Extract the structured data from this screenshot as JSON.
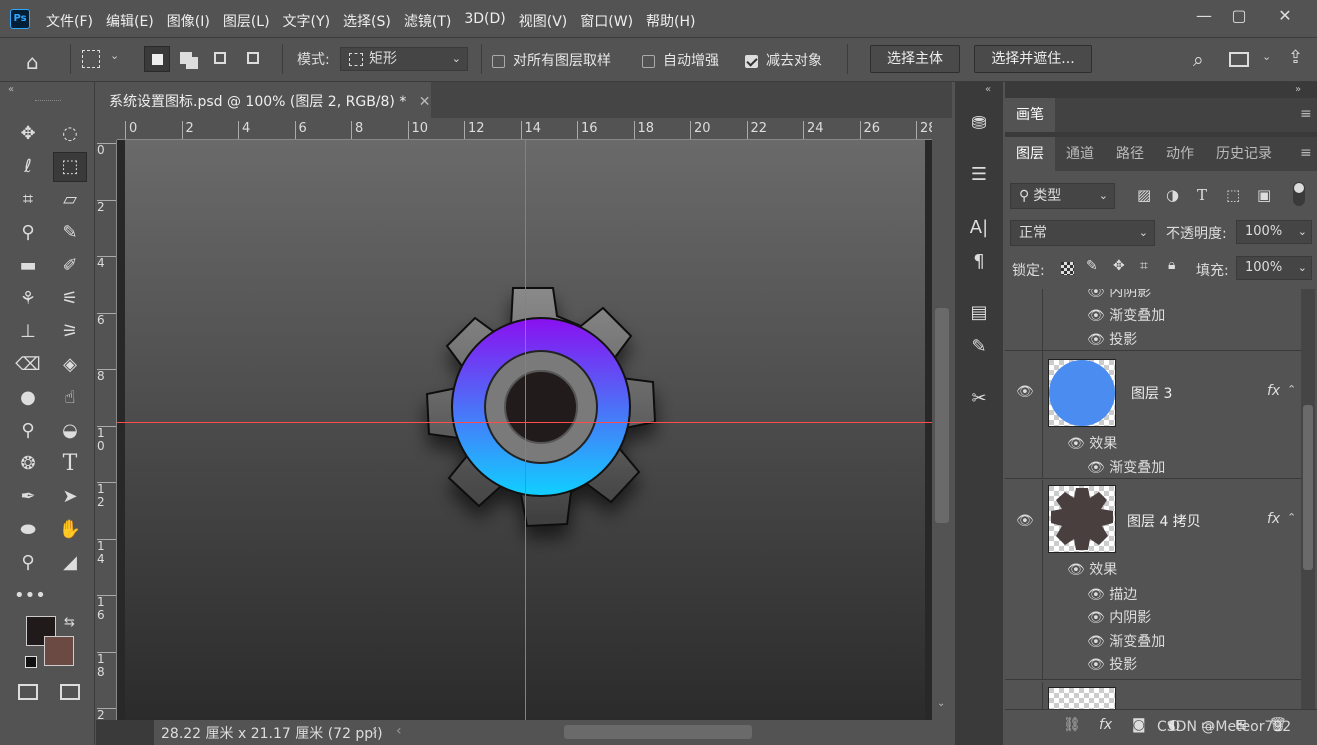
{
  "app": {
    "logo": "Ps",
    "menu": [
      "文件(F)",
      "编辑(E)",
      "图像(I)",
      "图层(L)",
      "文字(Y)",
      "选择(S)",
      "滤镜(T)",
      "3D(D)",
      "视图(V)",
      "窗口(W)",
      "帮助(H)"
    ]
  },
  "options": {
    "mode_label": "模式:",
    "mode_value": "矩形",
    "sample_all_label": "对所有图层取样",
    "auto_enhance_label": "自动增强",
    "subtract_label": "减去对象",
    "select_subject": "选择主体",
    "select_mask": "选择并遮住..."
  },
  "document": {
    "tab_title": "系统设置图标.psd @ 100% (图层 2, RGB/8) *",
    "status": "28.22 厘米 x 21.17 厘米 (72 ppi)"
  },
  "ruler": {
    "h_ticks": [
      "0",
      "2",
      "4",
      "6",
      "8",
      "10",
      "12",
      "14",
      "16",
      "18",
      "20",
      "22",
      "24",
      "26",
      "28"
    ],
    "v_ticks": [
      "0",
      "2",
      "4",
      "6",
      "8",
      "1\n0",
      "1\n2",
      "1\n4",
      "1\n6",
      "1\n8",
      "2"
    ]
  },
  "panels": {
    "brush_tab": "画笔",
    "tabs": [
      "图层",
      "通道",
      "路径",
      "动作",
      "历史记录"
    ],
    "filter_kind": "类型",
    "blend_mode": "正常",
    "opacity_label": "不透明度:",
    "opacity_value": "100%",
    "lock_label": "锁定:",
    "fill_label": "填充:",
    "fill_value": "100%"
  },
  "layers": {
    "top_effects": [
      "内阴影",
      "渐变叠加",
      "投影"
    ],
    "layer3": {
      "name": "图层 3",
      "effects_label": "效果",
      "effects": [
        "渐变叠加"
      ],
      "thumb_color": "#4a8cf0"
    },
    "layer4copy": {
      "name": "图层 4 拷贝",
      "effects_label": "效果",
      "effects": [
        "描边",
        "内阴影",
        "渐变叠加",
        "投影"
      ]
    },
    "fx_label": "fx"
  },
  "watermark": "CSDN @Meteor792",
  "colors": {
    "foreground": "#201a1a",
    "background": "#6b4a44",
    "guide": "#ff4d4d",
    "gear_gradient_top": "#8a10f0",
    "gear_gradient_bottom": "#10d0ff"
  }
}
